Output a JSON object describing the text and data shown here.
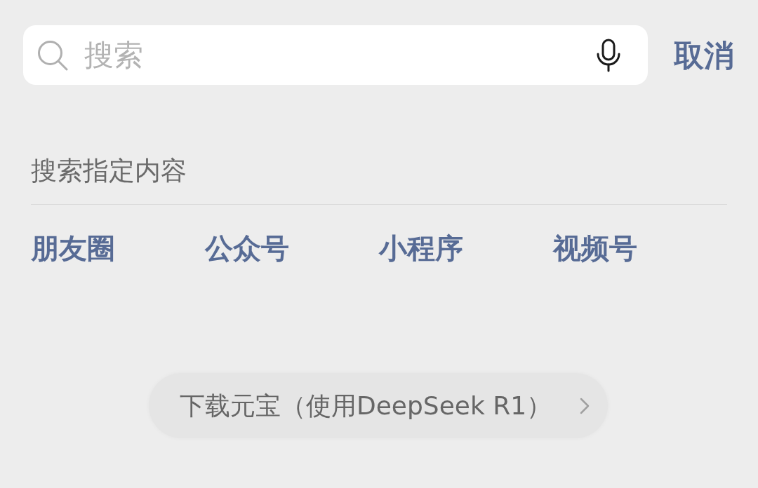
{
  "search_bar": {
    "placeholder": "搜索"
  },
  "cancel_button": "取消",
  "section": {
    "title": "搜索指定内容",
    "categories": [
      {
        "label": "朋友圈"
      },
      {
        "label": "公众号"
      },
      {
        "label": "小程序"
      },
      {
        "label": "视频号"
      }
    ]
  },
  "promo": {
    "label": "下载元宝（使用DeepSeek R1）"
  }
}
